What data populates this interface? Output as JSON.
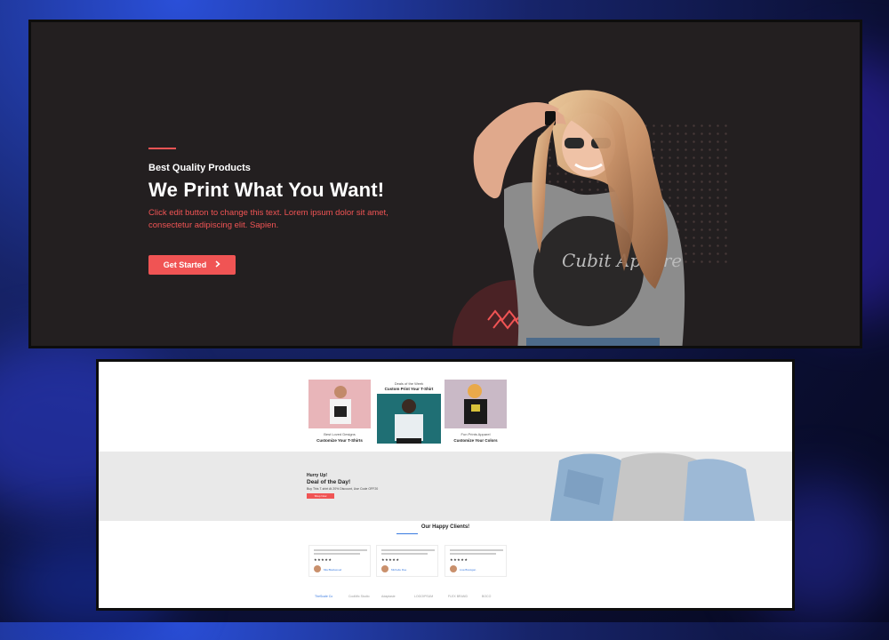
{
  "hero": {
    "eyebrow": "Best Quality Products",
    "headline": "We Print What You Want!",
    "description": "Click edit button to change this text. Lorem ipsum dolor sit amet, consectetur adipiscing elit. Sapien.",
    "cta_label": "Get Started",
    "cta_icon": "chevron-right-icon",
    "shirt_print": "Cubit Appare",
    "accent_color": "#f05454",
    "background_color": "#231f20"
  },
  "products": {
    "items": [
      {
        "caption": "Best Loved Designs",
        "title": "Customize Your T-Shirts"
      },
      {
        "caption": "Deals of the Week",
        "title": "Custom Print Your T-Shirt"
      },
      {
        "caption": "Fun Prints Apparel",
        "title": "Customize Your Colors"
      }
    ]
  },
  "deal": {
    "kicker": "Hurry Up!",
    "title": "Deal of the Day!",
    "subtitle": "Buy This T-shirt At 20% Discount, Use Code OFF20",
    "button": "Shop Now"
  },
  "testimonials": {
    "heading": "Our Happy Clients!",
    "stars": "★★★★★",
    "items": [
      {
        "name": "Mia Blackwood"
      },
      {
        "name": "Michelle Roe"
      },
      {
        "name": "Lisa Branigan"
      }
    ]
  },
  "logos": [
    "TheScale Co",
    "CoolMix Studio",
    "Adaptasie",
    "LOGOIPSUM",
    "FLEX BRAND",
    "BOCO"
  ]
}
